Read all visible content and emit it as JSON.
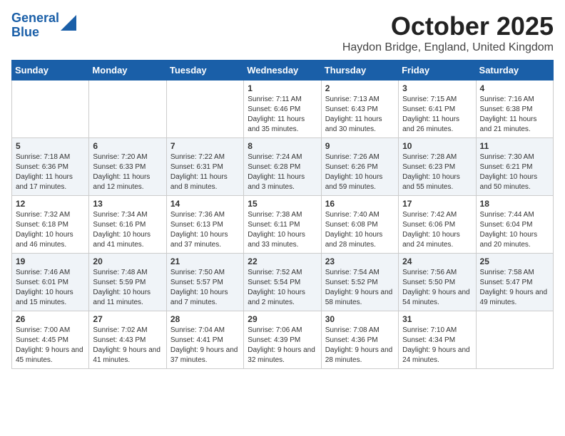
{
  "header": {
    "logo_line1": "General",
    "logo_line2": "Blue",
    "month_title": "October 2025",
    "location": "Haydon Bridge, England, United Kingdom"
  },
  "weekdays": [
    "Sunday",
    "Monday",
    "Tuesday",
    "Wednesday",
    "Thursday",
    "Friday",
    "Saturday"
  ],
  "weeks": [
    [
      {
        "day": "",
        "info": ""
      },
      {
        "day": "",
        "info": ""
      },
      {
        "day": "",
        "info": ""
      },
      {
        "day": "1",
        "info": "Sunrise: 7:11 AM\nSunset: 6:46 PM\nDaylight: 11 hours and 35 minutes."
      },
      {
        "day": "2",
        "info": "Sunrise: 7:13 AM\nSunset: 6:43 PM\nDaylight: 11 hours and 30 minutes."
      },
      {
        "day": "3",
        "info": "Sunrise: 7:15 AM\nSunset: 6:41 PM\nDaylight: 11 hours and 26 minutes."
      },
      {
        "day": "4",
        "info": "Sunrise: 7:16 AM\nSunset: 6:38 PM\nDaylight: 11 hours and 21 minutes."
      }
    ],
    [
      {
        "day": "5",
        "info": "Sunrise: 7:18 AM\nSunset: 6:36 PM\nDaylight: 11 hours and 17 minutes."
      },
      {
        "day": "6",
        "info": "Sunrise: 7:20 AM\nSunset: 6:33 PM\nDaylight: 11 hours and 12 minutes."
      },
      {
        "day": "7",
        "info": "Sunrise: 7:22 AM\nSunset: 6:31 PM\nDaylight: 11 hours and 8 minutes."
      },
      {
        "day": "8",
        "info": "Sunrise: 7:24 AM\nSunset: 6:28 PM\nDaylight: 11 hours and 3 minutes."
      },
      {
        "day": "9",
        "info": "Sunrise: 7:26 AM\nSunset: 6:26 PM\nDaylight: 10 hours and 59 minutes."
      },
      {
        "day": "10",
        "info": "Sunrise: 7:28 AM\nSunset: 6:23 PM\nDaylight: 10 hours and 55 minutes."
      },
      {
        "day": "11",
        "info": "Sunrise: 7:30 AM\nSunset: 6:21 PM\nDaylight: 10 hours and 50 minutes."
      }
    ],
    [
      {
        "day": "12",
        "info": "Sunrise: 7:32 AM\nSunset: 6:18 PM\nDaylight: 10 hours and 46 minutes."
      },
      {
        "day": "13",
        "info": "Sunrise: 7:34 AM\nSunset: 6:16 PM\nDaylight: 10 hours and 41 minutes."
      },
      {
        "day": "14",
        "info": "Sunrise: 7:36 AM\nSunset: 6:13 PM\nDaylight: 10 hours and 37 minutes."
      },
      {
        "day": "15",
        "info": "Sunrise: 7:38 AM\nSunset: 6:11 PM\nDaylight: 10 hours and 33 minutes."
      },
      {
        "day": "16",
        "info": "Sunrise: 7:40 AM\nSunset: 6:08 PM\nDaylight: 10 hours and 28 minutes."
      },
      {
        "day": "17",
        "info": "Sunrise: 7:42 AM\nSunset: 6:06 PM\nDaylight: 10 hours and 24 minutes."
      },
      {
        "day": "18",
        "info": "Sunrise: 7:44 AM\nSunset: 6:04 PM\nDaylight: 10 hours and 20 minutes."
      }
    ],
    [
      {
        "day": "19",
        "info": "Sunrise: 7:46 AM\nSunset: 6:01 PM\nDaylight: 10 hours and 15 minutes."
      },
      {
        "day": "20",
        "info": "Sunrise: 7:48 AM\nSunset: 5:59 PM\nDaylight: 10 hours and 11 minutes."
      },
      {
        "day": "21",
        "info": "Sunrise: 7:50 AM\nSunset: 5:57 PM\nDaylight: 10 hours and 7 minutes."
      },
      {
        "day": "22",
        "info": "Sunrise: 7:52 AM\nSunset: 5:54 PM\nDaylight: 10 hours and 2 minutes."
      },
      {
        "day": "23",
        "info": "Sunrise: 7:54 AM\nSunset: 5:52 PM\nDaylight: 9 hours and 58 minutes."
      },
      {
        "day": "24",
        "info": "Sunrise: 7:56 AM\nSunset: 5:50 PM\nDaylight: 9 hours and 54 minutes."
      },
      {
        "day": "25",
        "info": "Sunrise: 7:58 AM\nSunset: 5:47 PM\nDaylight: 9 hours and 49 minutes."
      }
    ],
    [
      {
        "day": "26",
        "info": "Sunrise: 7:00 AM\nSunset: 4:45 PM\nDaylight: 9 hours and 45 minutes."
      },
      {
        "day": "27",
        "info": "Sunrise: 7:02 AM\nSunset: 4:43 PM\nDaylight: 9 hours and 41 minutes."
      },
      {
        "day": "28",
        "info": "Sunrise: 7:04 AM\nSunset: 4:41 PM\nDaylight: 9 hours and 37 minutes."
      },
      {
        "day": "29",
        "info": "Sunrise: 7:06 AM\nSunset: 4:39 PM\nDaylight: 9 hours and 32 minutes."
      },
      {
        "day": "30",
        "info": "Sunrise: 7:08 AM\nSunset: 4:36 PM\nDaylight: 9 hours and 28 minutes."
      },
      {
        "day": "31",
        "info": "Sunrise: 7:10 AM\nSunset: 4:34 PM\nDaylight: 9 hours and 24 minutes."
      },
      {
        "day": "",
        "info": ""
      }
    ]
  ]
}
